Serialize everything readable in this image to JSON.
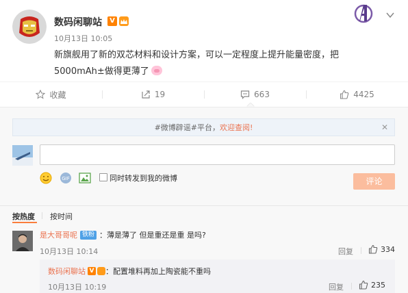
{
  "post": {
    "username": "数码闲聊站",
    "verified_badge": "V",
    "time": "10月13日 10:05",
    "text_line1": "新旗舰用了新的双芯材料和设计方案，可以一定程度上提升能量密度，把",
    "text_line2": "5000mAh±做得更薄了",
    "avatar_icon": "iron-man-avatar",
    "emoji_icon": "pig-emoji-icon"
  },
  "actions": {
    "favorite_label": "收藏",
    "repost_count": "19",
    "comment_count": "663",
    "like_count": "4425"
  },
  "composer": {
    "notice_prefix": "#微博辟谣#平台，",
    "notice_link": "欢迎查阅!",
    "close_glyph": "✕",
    "repost_label": "同时转发到我的微博",
    "submit_label": "评论"
  },
  "sort": {
    "hot_label": "按热度",
    "time_label": "按时间"
  },
  "comments": [
    {
      "name": "是大哥哥呢",
      "badge": "铁粉",
      "text": "：薄是薄了 但是重还是重 是吗?",
      "time": "10月13日 10:14",
      "reply_label": "回复",
      "likes": "334"
    },
    {
      "name": "数码闲聊站",
      "verified_badge": "V",
      "text": "：配置堆料再加上陶瓷能不重吗",
      "time": "10月13日 10:19",
      "reply_label": "回复",
      "likes": "235"
    }
  ],
  "colors": {
    "accent": "#eb7350",
    "submit_disabled": "#fbbd9e",
    "verified_orange": "#ff8200"
  }
}
